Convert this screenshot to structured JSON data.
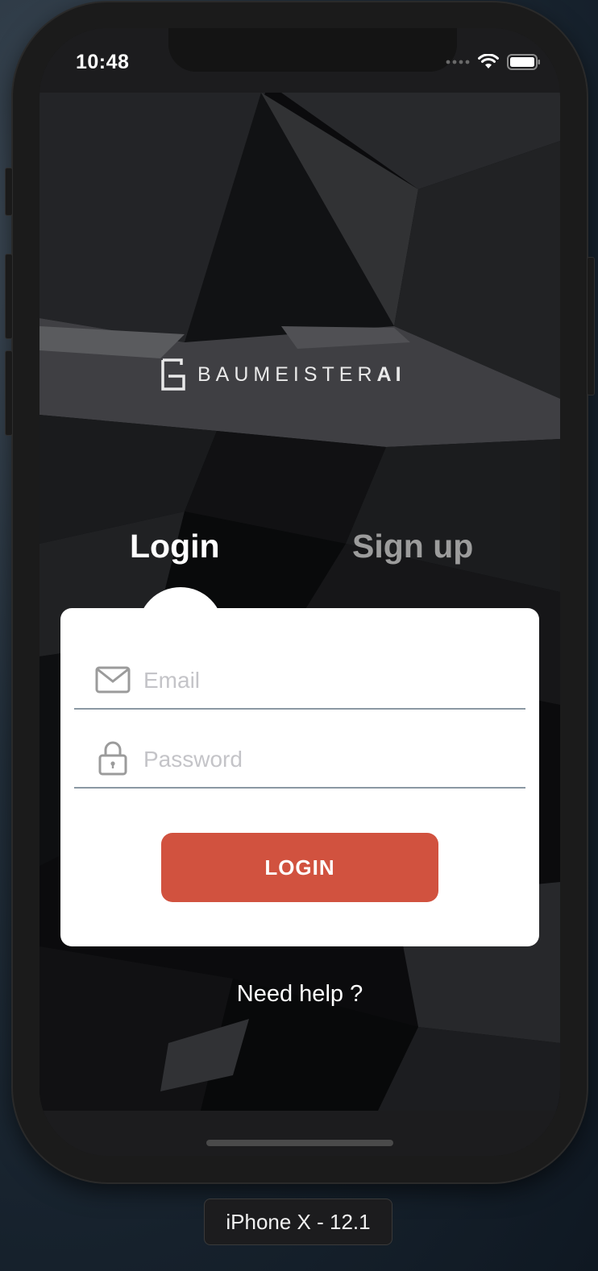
{
  "status_bar": {
    "time": "10:48"
  },
  "brand": {
    "name_light": "BAUMEISTER",
    "name_bold": "AI"
  },
  "tabs": [
    {
      "label": "Login",
      "active": true
    },
    {
      "label": "Sign up",
      "active": false
    }
  ],
  "form": {
    "email": {
      "placeholder": "Email",
      "value": "",
      "icon": "envelope-icon"
    },
    "password": {
      "placeholder": "Password",
      "value": "",
      "icon": "lock-icon"
    },
    "submit_label": "LOGIN"
  },
  "help_link": "Need help ?",
  "simulator": {
    "device_label": "iPhone X - 12.1"
  },
  "colors": {
    "accent": "#d1523f",
    "tab_active": "#ffffff",
    "tab_inactive": "#9c9c9c",
    "card": "#ffffff"
  }
}
